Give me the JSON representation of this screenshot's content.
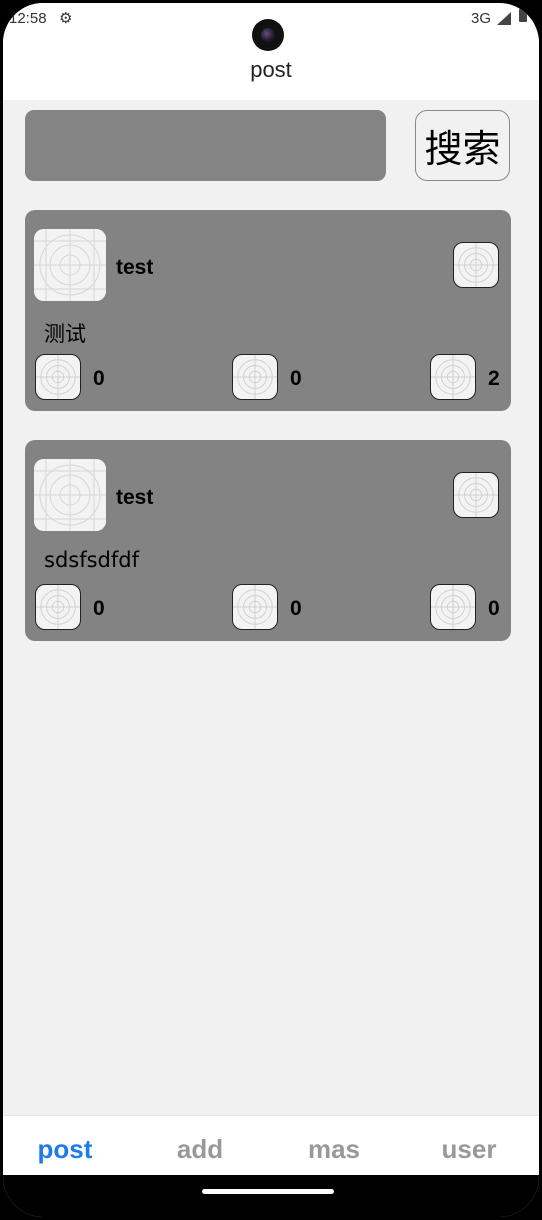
{
  "status_bar": {
    "time": "12:58",
    "network": "3G",
    "icons": [
      "gear-icon",
      "signal-icon",
      "battery-icon"
    ]
  },
  "app_bar": {
    "title": "post"
  },
  "search": {
    "value": "",
    "button_label": "搜索"
  },
  "posts": [
    {
      "author": "test",
      "text": "测试",
      "like_count": "0",
      "comment_count": "0",
      "share_count": "2"
    },
    {
      "author": "test",
      "text": "sdsfsdfdf",
      "like_count": "0",
      "comment_count": "0",
      "share_count": "0"
    }
  ],
  "tab_bar": {
    "tabs": [
      {
        "label": "post",
        "active": true
      },
      {
        "label": "add",
        "active": false
      },
      {
        "label": "mas",
        "active": false
      },
      {
        "label": "user",
        "active": false
      }
    ]
  },
  "colors": {
    "accent": "#1e7ce8",
    "card": "#838383",
    "background": "#f1f1f1",
    "inactive_tab": "#999999"
  }
}
